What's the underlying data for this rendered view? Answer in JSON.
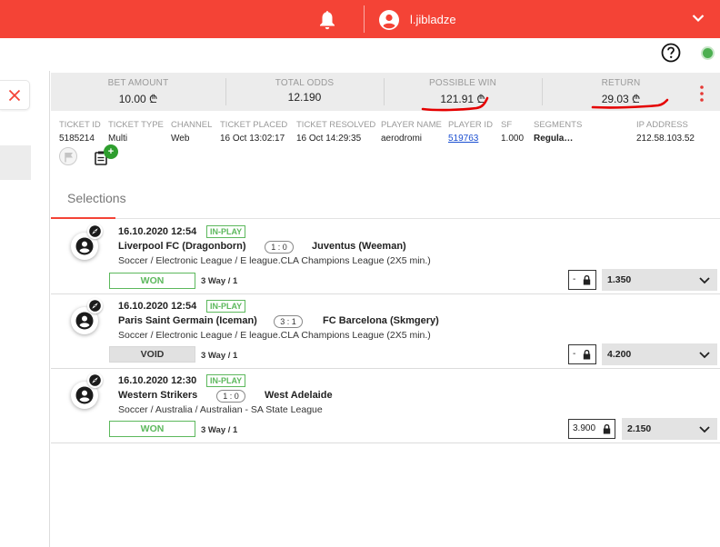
{
  "topbar": {
    "username": "l.jibladze",
    "accent": "#f44336"
  },
  "summary": {
    "bet_amount_label": "BET AMOUNT",
    "bet_amount": "10.00 ₾",
    "total_odds_label": "TOTAL ODDS",
    "total_odds": "12.190",
    "possible_win_label": "POSSIBLE WIN",
    "possible_win": "121.91 ₾",
    "return_label": "RETURN",
    "return_value": "29.03 ₾"
  },
  "ticket": {
    "labels": {
      "ticket_id": "TICKET ID",
      "ticket_type": "TICKET TYPE",
      "channel": "CHANNEL",
      "placed": "TICKET PLACED",
      "resolved": "TICKET RESOLVED",
      "player_name": "PLAYER NAME",
      "player_id": "PLAYER ID",
      "sf": "SF",
      "segments": "SEGMENTS",
      "ip": "IP ADDRESS"
    },
    "ticket_id": "5185214",
    "ticket_type": "Multi",
    "channel": "Web",
    "placed": "16 Oct 13:02:17",
    "resolved": "16 Oct 14:29:35",
    "player_name": "aerodromi",
    "player_id": "519763",
    "sf": "1.000",
    "segments": "Regula…",
    "ip": "212.58.103.52",
    "note_plus": "+"
  },
  "tabs": {
    "selections": "Selections"
  },
  "selections": [
    {
      "datetime": "16.10.2020 12:54",
      "status_badge": "IN-PLAY",
      "home": "Liverpool FC (Dragonborn)",
      "score": "1 : 0",
      "away": "Juventus (Weeman)",
      "league": "Soccer / Electronic League / E league.CLA Champions League (2X5 min.)",
      "result": "WON",
      "market": "3 Way / 1",
      "lock_value": "-",
      "odds": "1.350"
    },
    {
      "datetime": "16.10.2020 12:54",
      "status_badge": "IN-PLAY",
      "home": "Paris Saint Germain (Iceman)",
      "score": "3 : 1",
      "away": "FC Barcelona (Skmgery)",
      "league": "Soccer / Electronic League / E league.CLA Champions League (2X5 min.)",
      "result": "VOID",
      "market": "3 Way / 1",
      "lock_value": "-",
      "odds": "4.200"
    },
    {
      "datetime": "16.10.2020 12:30",
      "status_badge": "IN-PLAY",
      "home": "Western Strikers",
      "score": "1 : 0",
      "away": "West Adelaide",
      "league": "Soccer / Australia / Australian - SA State League",
      "result": "WON",
      "market": "3 Way / 1",
      "lock_value": "3.900",
      "odds": "2.150"
    }
  ]
}
